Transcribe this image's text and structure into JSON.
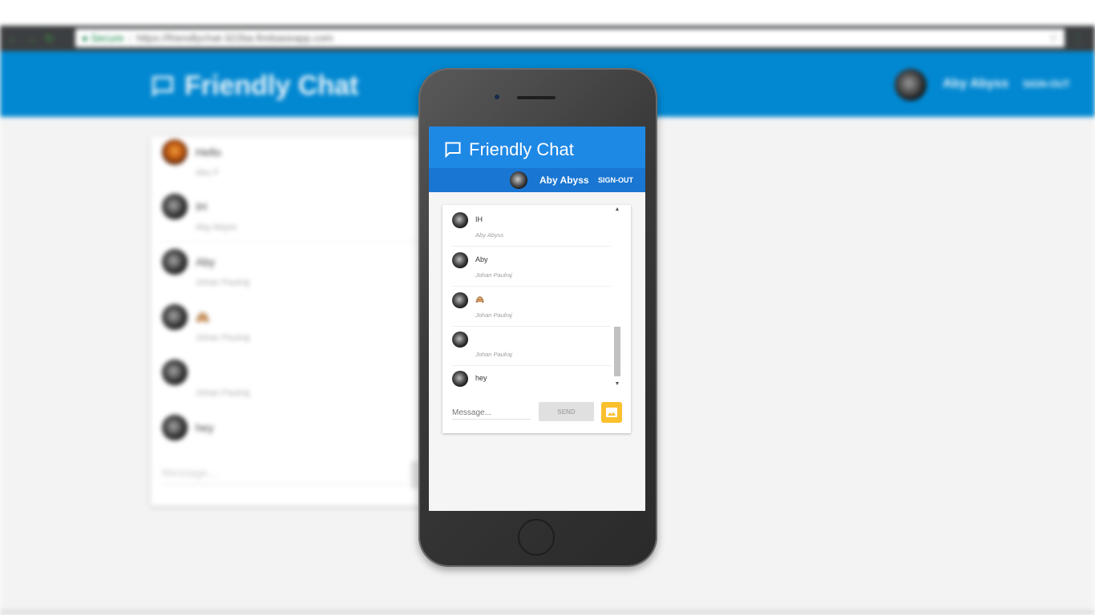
{
  "browser": {
    "secure_label": "Secure",
    "url": "https://friendlychat-322ba.firebaseapp.com"
  },
  "desktop_app": {
    "title": "Friendly Chat",
    "user_name": "Aby Abyss",
    "sign_out": "SIGN-OUT",
    "messages": [
      {
        "text": "Hello",
        "name": "Abu F"
      },
      {
        "text": "IH",
        "name": "Aby Abyss"
      },
      {
        "text": "Aby",
        "name": "Johan Paulraj"
      },
      {
        "text": "🙈",
        "name": "Johan Paulraj"
      },
      {
        "text": "",
        "name": "Johan Paulraj"
      },
      {
        "text": "hey",
        "name": ""
      }
    ],
    "message_placeholder": "Message..."
  },
  "phone_app": {
    "title": "Friendly Chat",
    "user_name": "Aby Abyss",
    "sign_out": "SIGN-OUT",
    "messages": [
      {
        "text": "IH",
        "name": "Aby Abyss"
      },
      {
        "text": "Aby",
        "name": "Johan Paulraj"
      },
      {
        "text": "🙈",
        "name": "Johan Paulraj"
      },
      {
        "text": "",
        "name": "Johan Paulraj"
      },
      {
        "text": "hey",
        "name": ""
      }
    ],
    "message_placeholder": "Message...",
    "send_label": "SEND",
    "icons": {
      "title": "chat-bubble-icon",
      "image": "image-icon"
    }
  },
  "colors": {
    "header_blue": "#1e88e5",
    "subbar_blue": "#1976d2",
    "desktop_header_blue": "#0288d1",
    "image_button_yellow": "#fbc02d"
  }
}
